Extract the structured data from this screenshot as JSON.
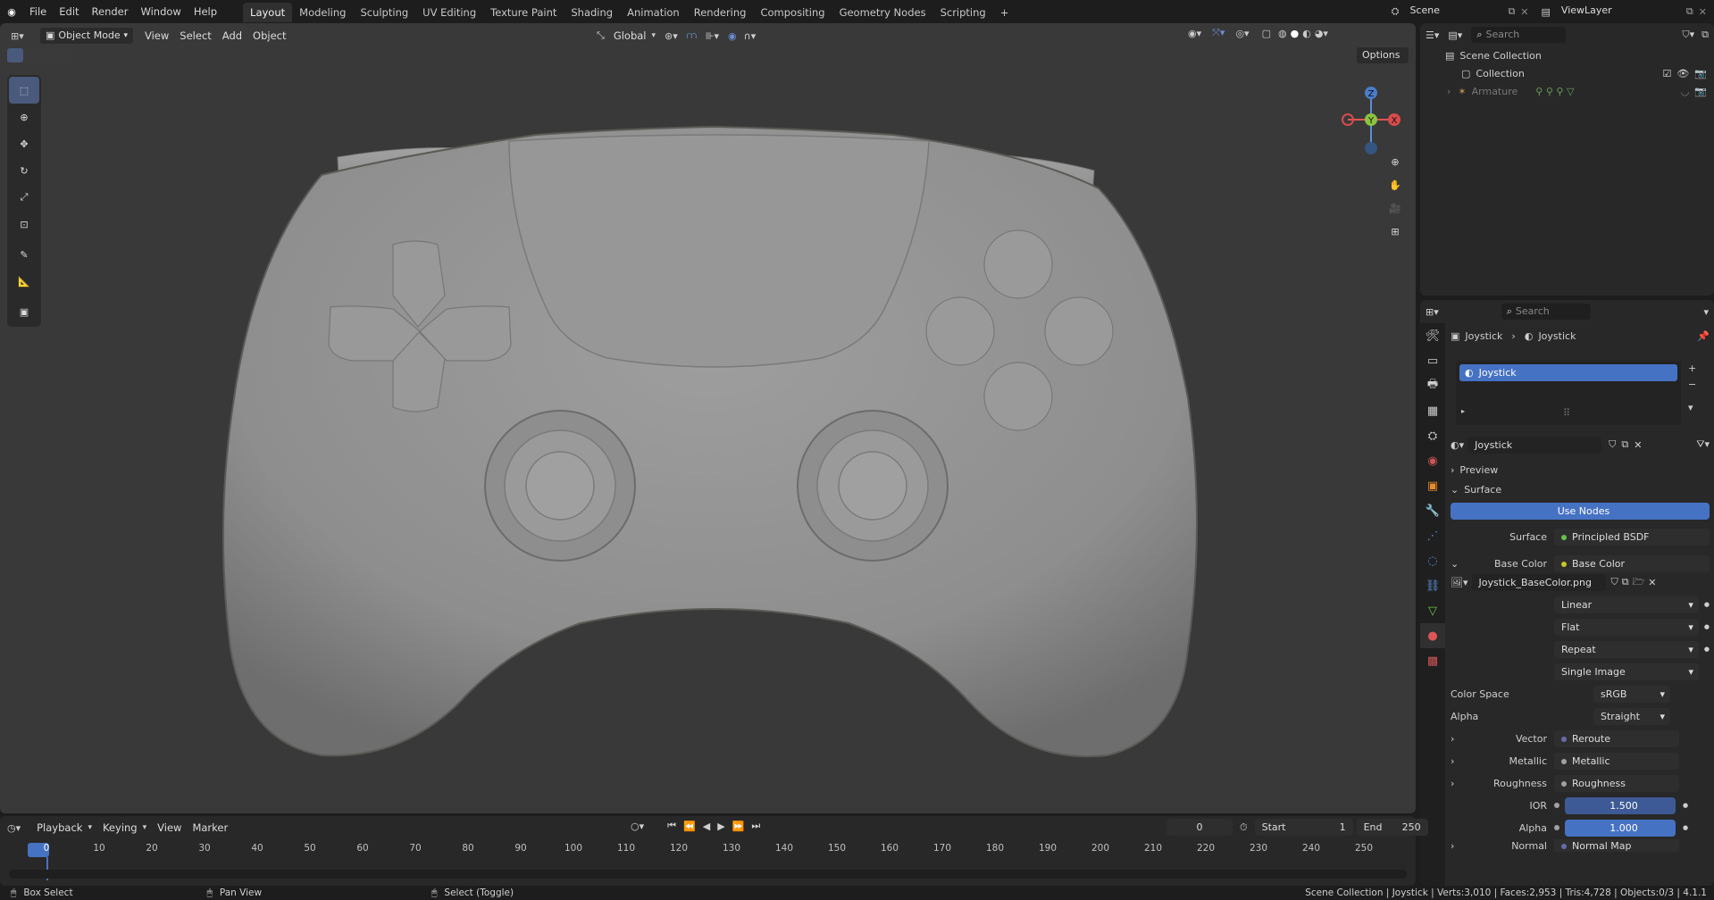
{
  "menubar": {
    "menus": [
      "File",
      "Edit",
      "Render",
      "Window",
      "Help"
    ],
    "workspaces": [
      "Layout",
      "Modeling",
      "Sculpting",
      "UV Editing",
      "Texture Paint",
      "Shading",
      "Animation",
      "Rendering",
      "Compositing",
      "Geometry Nodes",
      "Scripting"
    ],
    "active_workspace": "Layout",
    "add_tab": "+",
    "scene": "Scene",
    "view_layer": "ViewLayer"
  },
  "viewport": {
    "mode": "Object Mode",
    "menus": [
      "View",
      "Select",
      "Add",
      "Object"
    ],
    "transform_orientation": "Global",
    "options_label": "Options",
    "gizmo": {
      "x": "X",
      "y": "Y",
      "z": "Z"
    }
  },
  "outliner": {
    "search_placeholder": "Search",
    "items": [
      {
        "label": "Scene Collection"
      },
      {
        "label": "Collection"
      },
      {
        "label": "Armature"
      }
    ]
  },
  "properties": {
    "search_placeholder": "Search",
    "breadcrumb": [
      "Joystick",
      "Joystick"
    ],
    "slot": "Joystick",
    "material_name": "Joystick",
    "panels": {
      "preview": "Preview",
      "surface": "Surface"
    },
    "use_nodes": "Use Nodes",
    "rows": [
      {
        "label": "Surface",
        "value": "Principled BSDF"
      },
      {
        "label": "Base Color",
        "value": "Base Color"
      }
    ],
    "image_name": "Joystick_BaseColor.png",
    "image_options": [
      "Linear",
      "Flat",
      "Repeat",
      "Single Image"
    ],
    "color_space": {
      "label": "Color Space",
      "value": "sRGB"
    },
    "alpha_mode": {
      "label": "Alpha",
      "value": "Straight"
    },
    "sockets": [
      {
        "label": "Vector",
        "value": "Reroute"
      },
      {
        "label": "Metallic",
        "value": "Metallic"
      },
      {
        "label": "Roughness",
        "value": "Roughness"
      }
    ],
    "ior": {
      "label": "IOR",
      "value": "1.500"
    },
    "alpha": {
      "label": "Alpha",
      "value": "1.000"
    },
    "normal": {
      "label": "Normal",
      "value": "Normal Map"
    }
  },
  "timeline": {
    "menus": [
      "Playback",
      "Keying",
      "View",
      "Marker"
    ],
    "current_frame": "0",
    "start_label": "Start",
    "start": "1",
    "end_label": "End",
    "end": "250",
    "ticks": [
      "0",
      "10",
      "20",
      "30",
      "40",
      "50",
      "60",
      "70",
      "80",
      "90",
      "100",
      "110",
      "120",
      "130",
      "140",
      "150",
      "160",
      "170",
      "180",
      "190",
      "200",
      "210",
      "220",
      "230",
      "240",
      "250"
    ]
  },
  "statusbar": {
    "left": [
      "Box Select",
      "Pan View",
      "Select (Toggle)"
    ],
    "right": "Scene Collection | Joystick | Verts:3,010 | Faces:2,953 | Tris:4,728 | Objects:0/3 | 4.1.1"
  }
}
